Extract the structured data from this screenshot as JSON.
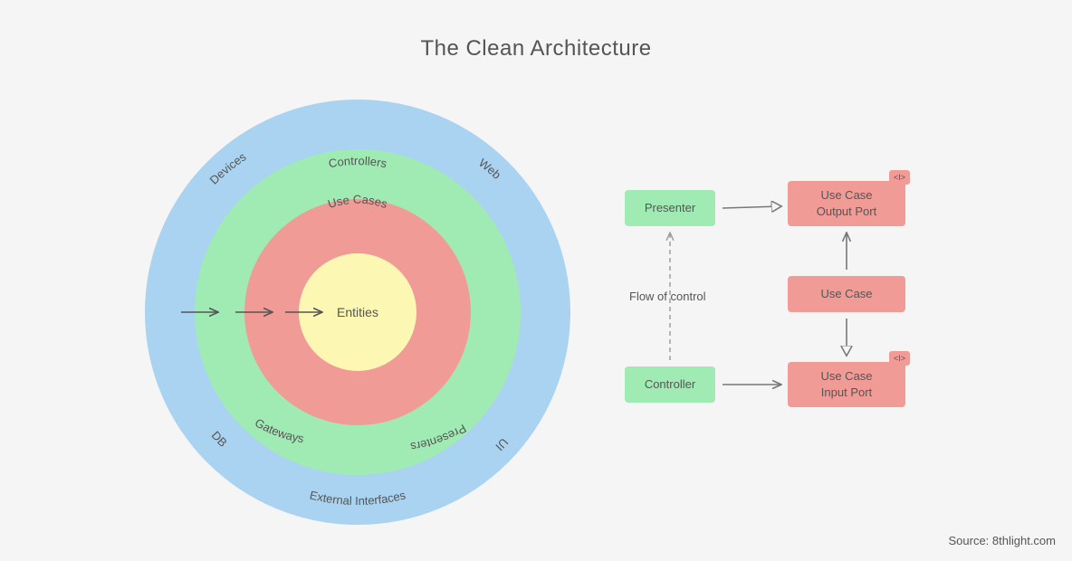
{
  "title": "The Clean Architecture",
  "source": "Source: 8thlight.com",
  "circles": {
    "center": "Entities",
    "ring3_top": "Use Cases",
    "ring2_top": "Controllers",
    "ring2_bottom_left": "Gateways",
    "ring2_bottom_right": "Presenters",
    "ring1_top_left": "Devices",
    "ring1_top_right": "Web",
    "ring1_bottom_left": "DB",
    "ring1_bottom_right": "UI",
    "ring1_bottom": "External Interfaces"
  },
  "flow": {
    "presenter": "Presenter",
    "output_port": "Use Case\nOutput Port",
    "use_case": "Use Case",
    "controller": "Controller",
    "input_port": "Use Case\nInput Port",
    "interface_tag": "<I>",
    "flow_label": "Flow of control"
  }
}
